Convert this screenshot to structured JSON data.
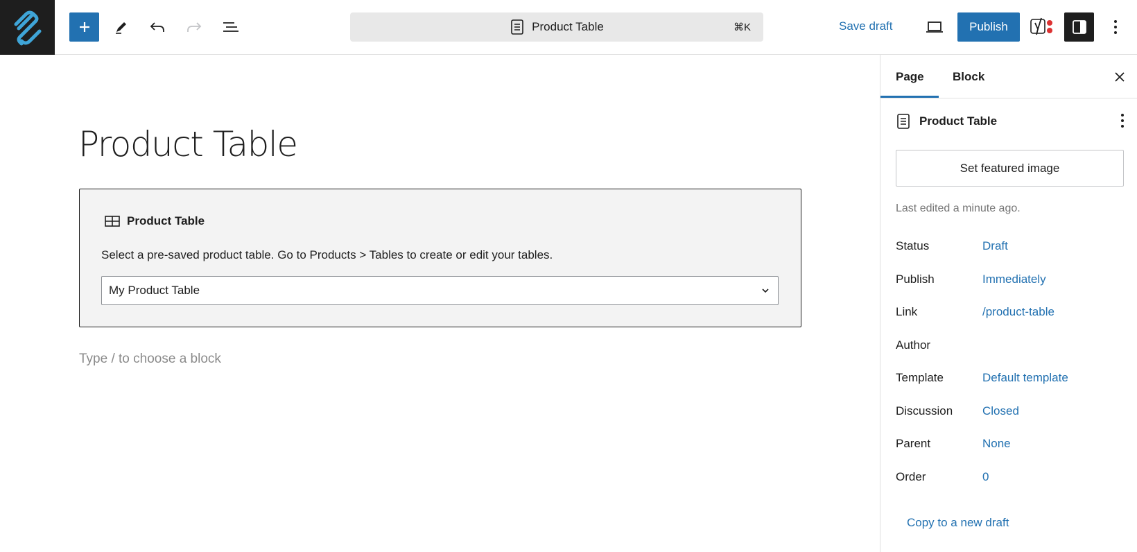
{
  "topbar": {
    "logo_icon": "site-logo-icon",
    "add_block_label": "Add block",
    "doc_title": "Product Table",
    "shortcut": "⌘K",
    "save_draft": "Save draft",
    "publish": "Publish",
    "accent_color": "#2271b1"
  },
  "editor": {
    "title": "Product Table",
    "block": {
      "label": "Product Table",
      "instructions": "Select a pre-saved product table. Go to Products > Tables to create or edit your tables.",
      "selected_table": "My Product Table"
    },
    "appender_placeholder": "Type / to choose a block"
  },
  "sidebar": {
    "tabs": [
      {
        "label": "Page",
        "active": true
      },
      {
        "label": "Block",
        "active": false
      }
    ],
    "doc_title": "Product Table",
    "featured_image_button": "Set featured image",
    "last_edited": "Last edited a minute ago.",
    "meta": [
      {
        "label": "Status",
        "value": "Draft"
      },
      {
        "label": "Publish",
        "value": "Immediately"
      },
      {
        "label": "Link",
        "value": "/product-table"
      },
      {
        "label": "Author",
        "value": ""
      },
      {
        "label": "Template",
        "value": "Default template"
      },
      {
        "label": "Discussion",
        "value": "Closed"
      },
      {
        "label": "Parent",
        "value": "None"
      },
      {
        "label": "Order",
        "value": "0"
      }
    ],
    "copy_draft": "Copy to a new draft"
  }
}
